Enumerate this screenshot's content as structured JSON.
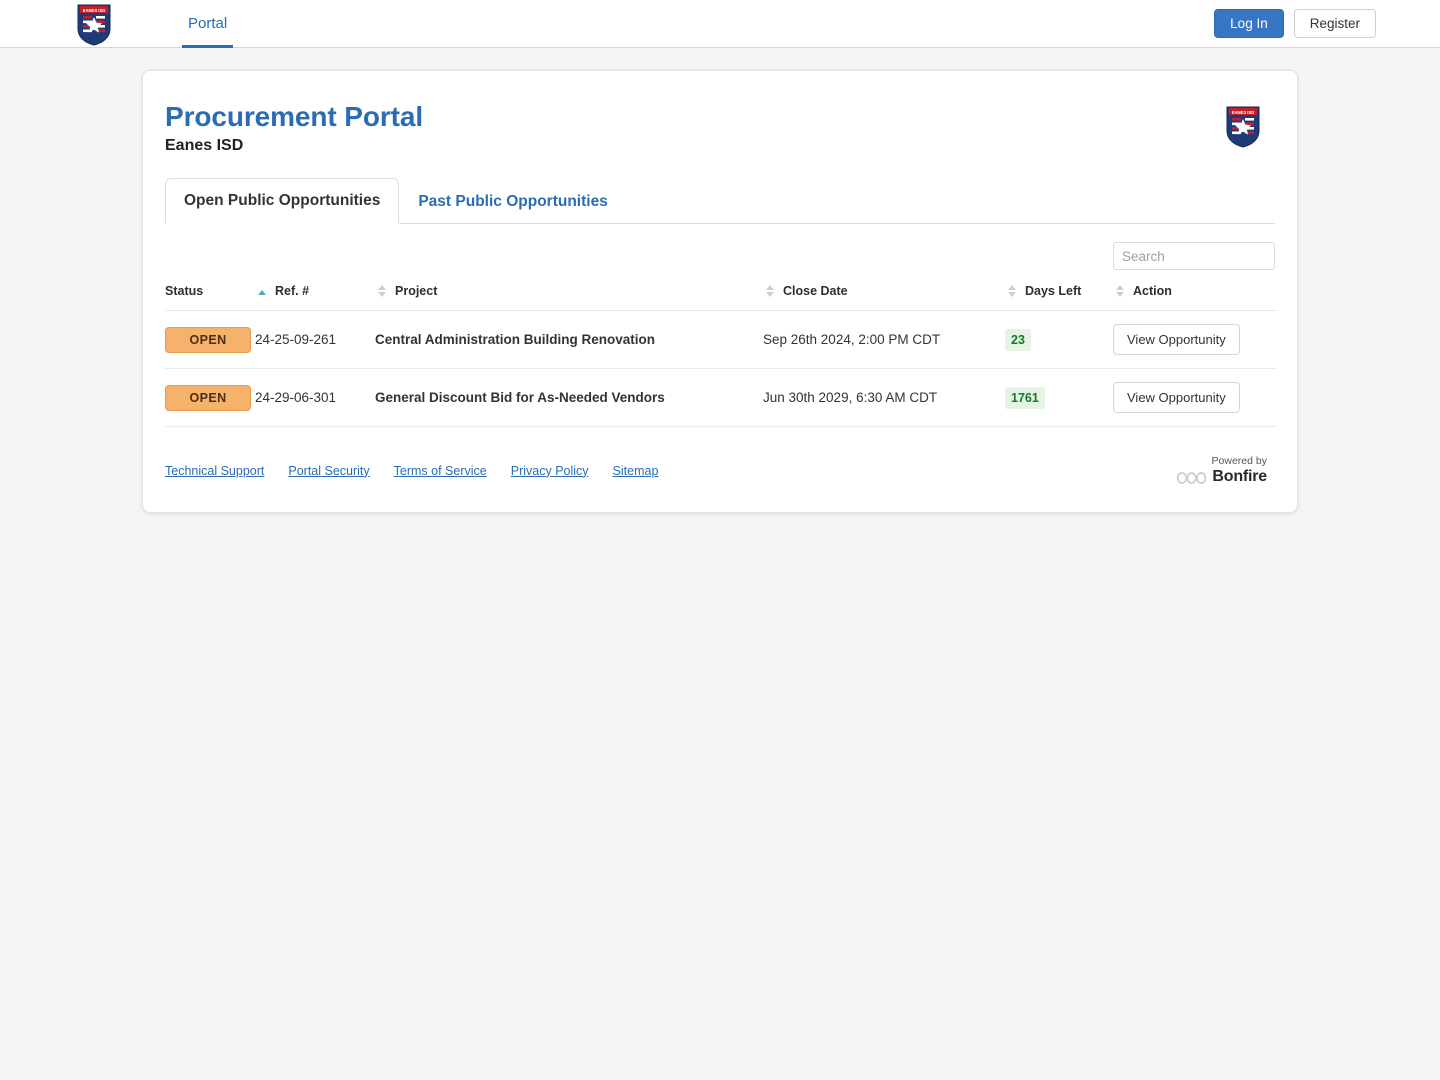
{
  "topbar": {
    "logo_alt": "Eanes ISD shield logo",
    "nav": [
      {
        "label": "Portal",
        "active": true
      }
    ],
    "login_label": "Log In",
    "register_label": "Register"
  },
  "header": {
    "title": "Procurement Portal",
    "subtitle": "Eanes ISD",
    "logo_alt": "Eanes ISD shield logo"
  },
  "tabs": [
    {
      "label": "Open Public Opportunities",
      "active": true
    },
    {
      "label": "Past Public Opportunities",
      "active": false
    }
  ],
  "search": {
    "placeholder": "Search",
    "value": ""
  },
  "table": {
    "columns": [
      {
        "label": "Status",
        "sort": "asc"
      },
      {
        "label": "Ref. #",
        "sort": "none"
      },
      {
        "label": "Project",
        "sort": "none"
      },
      {
        "label": "Close Date",
        "sort": "none"
      },
      {
        "label": "Days Left",
        "sort": "none"
      },
      {
        "label": "Action",
        "sort": null
      }
    ],
    "rows": [
      {
        "status": "OPEN",
        "ref": "24-25-09-261",
        "project": "Central Administration Building Renovation",
        "close_date": "Sep 26th 2024, 2:00 PM CDT",
        "days_left": "23",
        "action": "View Opportunity"
      },
      {
        "status": "OPEN",
        "ref": "24-29-06-301",
        "project": "General Discount Bid for As-Needed Vendors",
        "close_date": "Jun 30th 2029, 6:30 AM CDT",
        "days_left": "1761",
        "action": "View Opportunity"
      }
    ]
  },
  "footer": {
    "links": [
      "Technical Support",
      "Portal Security",
      "Terms of Service",
      "Privacy Policy",
      "Sitemap"
    ],
    "powered_by_label": "Powered by",
    "powered_by_brand": "Bonfire"
  },
  "colors": {
    "link_blue": "#2b6cb3",
    "primary_button": "#3776c4",
    "status_open_bg": "#f6b26b",
    "days_left_bg": "#e4f3e4",
    "days_left_text": "#137a26",
    "sort_active": "#5aa7c4"
  }
}
